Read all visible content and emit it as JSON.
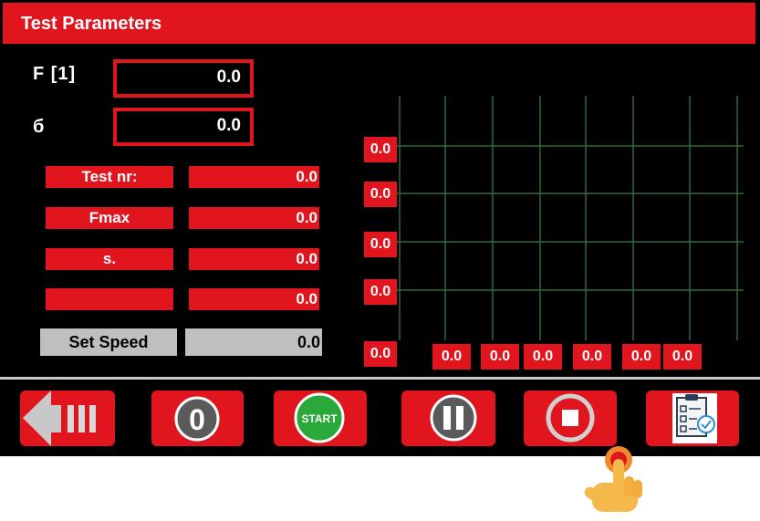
{
  "window": {
    "title": "Test Parameters"
  },
  "readouts": [
    {
      "label": "F [1]",
      "value": "0.0"
    },
    {
      "label": "б",
      "value": "0.0"
    }
  ],
  "rows": [
    {
      "label": "Test nr:",
      "value": "0.0"
    },
    {
      "label": "Fmax",
      "value": "0.0"
    },
    {
      "label": "s.",
      "value": "0.0"
    },
    {
      "label": "",
      "value": "0.0"
    }
  ],
  "speed": {
    "label": "Set Speed",
    "value": "0.0"
  },
  "graph": {
    "y_ticks": [
      "0.0",
      "0.0",
      "0.0",
      "0.0",
      "0.0"
    ],
    "x_ticks": [
      "0.0",
      "0.0",
      "0.0",
      "0.0",
      "0.0",
      "0.0"
    ]
  },
  "toolbar": {
    "back_icon": "back-arrow-icon",
    "zero_label": "0",
    "start_label": "START",
    "pause_icon": "pause-icon",
    "stop_icon": "stop-icon",
    "report_icon": "clipboard-checklist-icon"
  },
  "colors": {
    "accent": "#e0151e",
    "panel": "#000000",
    "grid": "#2f6b3a",
    "start": "#2aa83a",
    "gray": "#bfbfbf"
  }
}
